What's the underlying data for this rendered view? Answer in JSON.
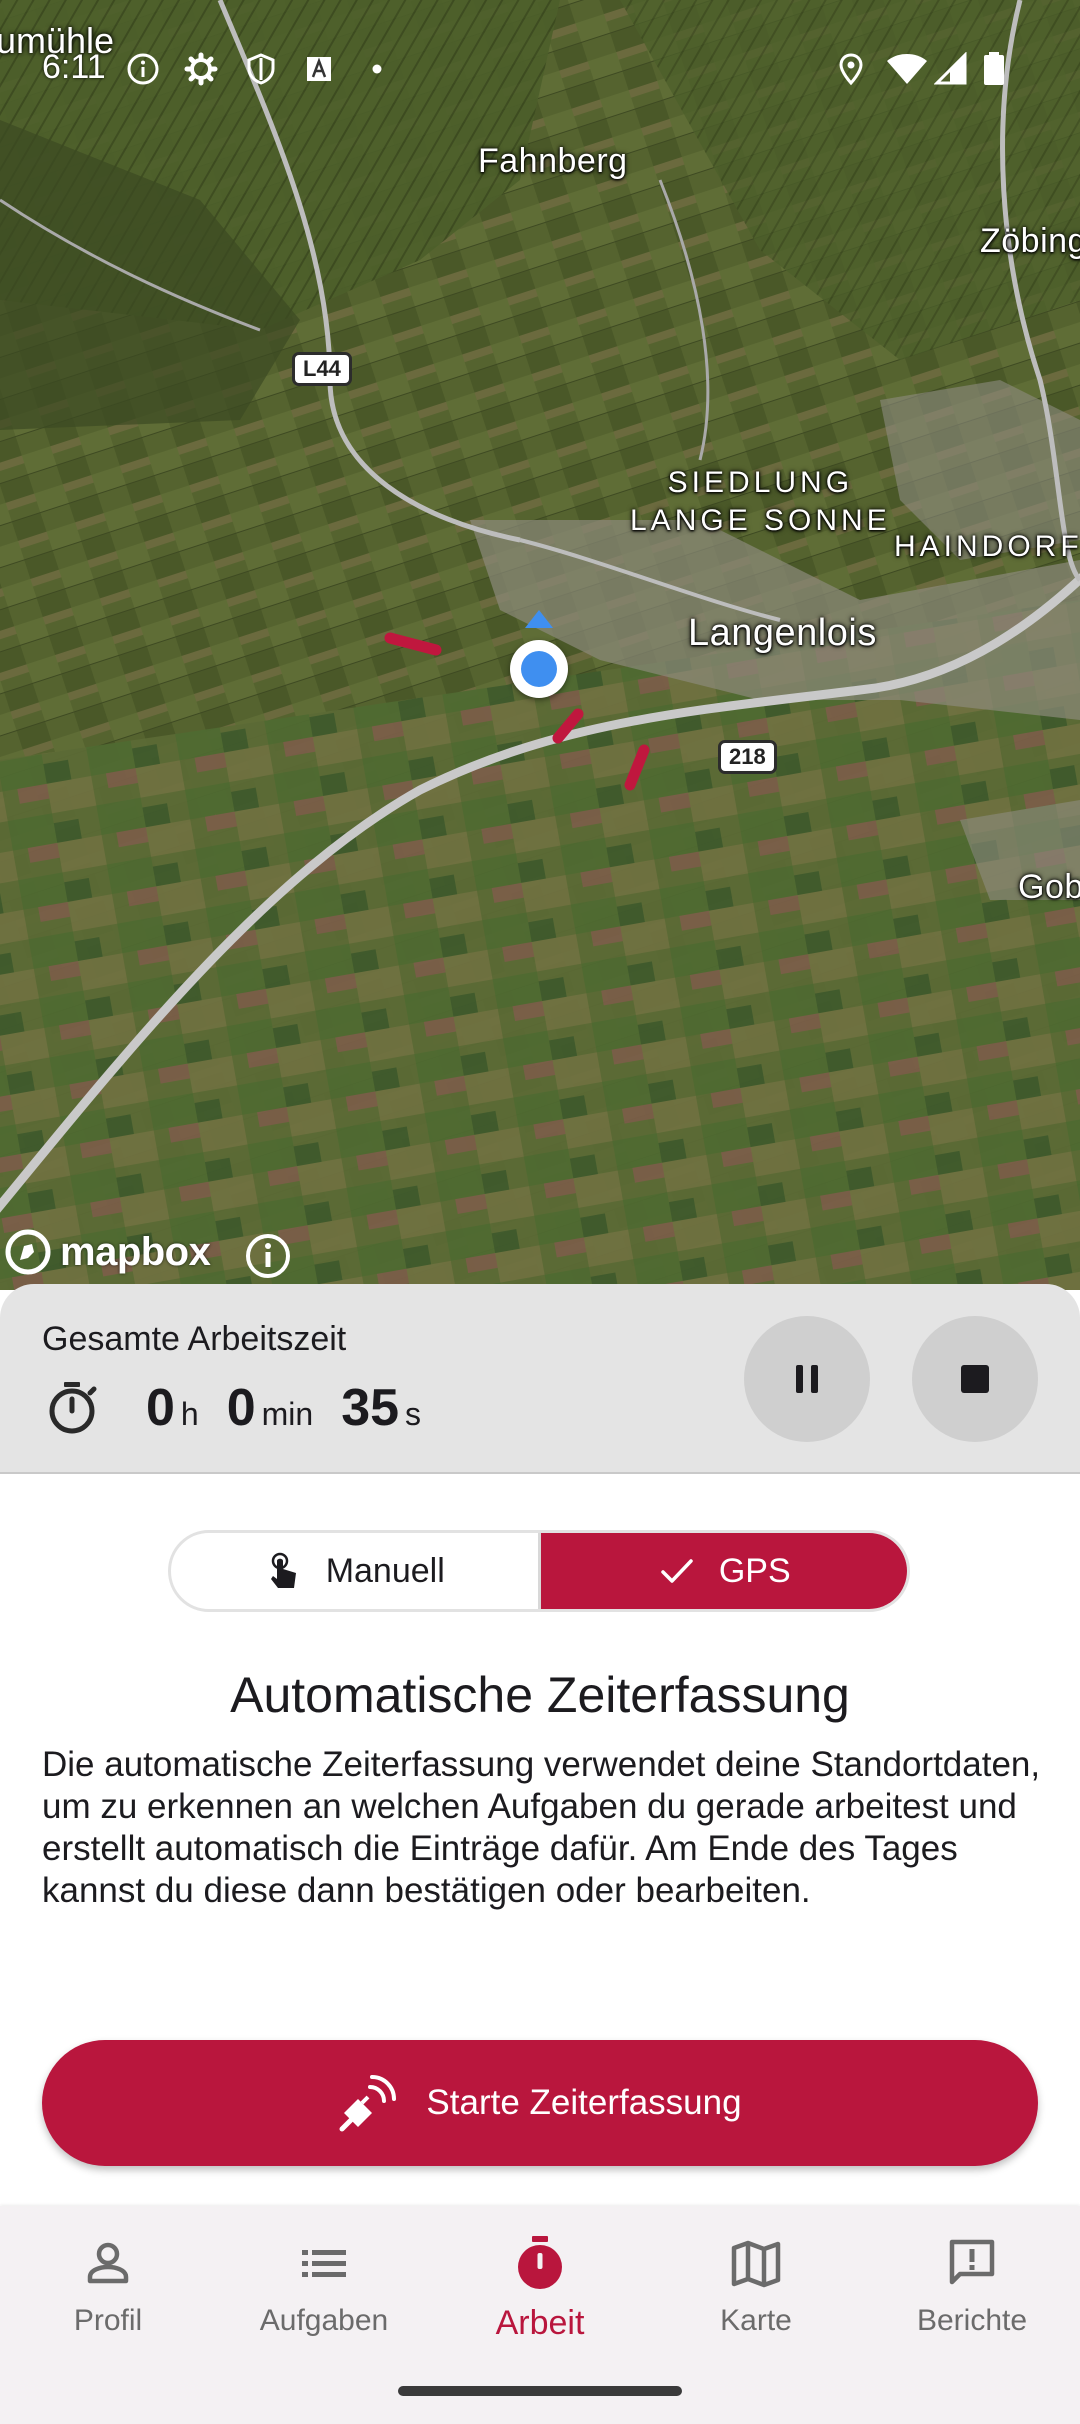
{
  "status_bar": {
    "time": "6:11",
    "left_icons": [
      "info-icon",
      "settings-icon",
      "shield-icon",
      "text-a-icon",
      "dot-icon"
    ],
    "right_icons": [
      "location-icon",
      "wifi-icon",
      "signal-icon",
      "battery-icon"
    ]
  },
  "map": {
    "labels": {
      "cut_top_left": "umühle",
      "fahnberg": "Fahnberg",
      "zoebing": "Zöbing",
      "siedlung_line1": "SIEDLUNG",
      "siedlung_line2": "LANGE SONNE",
      "haindorf": "HAINDORF",
      "langenlois": "Langenlois",
      "gob": "Gob"
    },
    "road_shields": {
      "l44": "L44",
      "r218": "218"
    },
    "attribution": {
      "brand": "mapbox"
    }
  },
  "timer": {
    "title": "Gesamte Arbeitszeit",
    "hours": "0",
    "hours_unit": "h",
    "minutes": "0",
    "minutes_unit": "min",
    "seconds": "35",
    "seconds_unit": "s"
  },
  "mode_toggle": {
    "manual_label": "Manuell",
    "gps_label": "GPS",
    "selected": "GPS"
  },
  "description": {
    "title": "Automatische Zeiterfassung",
    "text": "Die automatische Zeiterfassung verwendet deine Standortdaten, um zu erkennen an welchen Aufgaben du gerade arbeitest und erstellt automatisch die Einträge dafür. Am Ende des Tages kannst du diese dann bestätigen oder bearbeiten."
  },
  "start_button": {
    "label": "Starte Zeiterfassung"
  },
  "bottom_nav": {
    "items": [
      {
        "label": "Profil",
        "icon": "person-icon"
      },
      {
        "label": "Aufgaben",
        "icon": "list-icon"
      },
      {
        "label": "Arbeit",
        "icon": "timer-icon"
      },
      {
        "label": "Karte",
        "icon": "map-icon"
      },
      {
        "label": "Berichte",
        "icon": "report-icon"
      }
    ],
    "active": "Arbeit"
  },
  "colors": {
    "accent": "#b9163d",
    "panel_bg": "#e4e4e4",
    "nav_bg": "#f4f1f3",
    "location_puck": "#3f8ff0"
  }
}
